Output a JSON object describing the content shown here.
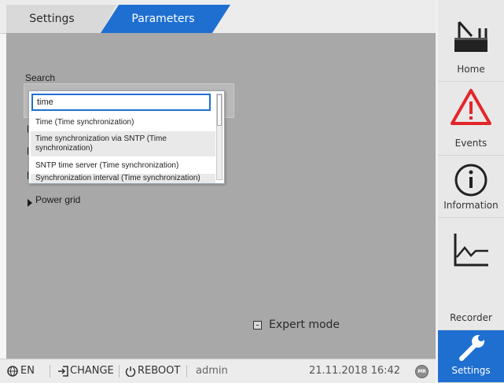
{
  "tabs": [
    {
      "label": "Settings",
      "active": false
    },
    {
      "label": "Parameters",
      "active": true
    }
  ],
  "search": {
    "label": "Search",
    "value": "time"
  },
  "tree_items": [
    {
      "label": ""
    },
    {
      "label": ""
    },
    {
      "label": ""
    },
    {
      "label": "Power grid"
    }
  ],
  "dropdown_options": [
    {
      "label": "Time (Time synchronization)"
    },
    {
      "label": "Time synchronization via SNTP (Time synchronization)"
    },
    {
      "label": "SNTP time server (Time synchronization)"
    },
    {
      "label": "Synchronization interval (Time synchronization)"
    }
  ],
  "expert_mode": {
    "label": "Expert mode",
    "checked": false
  },
  "nav": [
    {
      "label": "Home",
      "icon": "home-transformer-icon"
    },
    {
      "label": "Events",
      "icon": "warning-icon"
    },
    {
      "label": "Information",
      "icon": "info-icon"
    },
    {
      "label": "Recorder",
      "icon": "recorder-chart-icon"
    },
    {
      "label": "Settings",
      "icon": "wrench-icon",
      "active": true
    }
  ],
  "statusbar": {
    "language": "EN",
    "change": "CHANGE",
    "reboot": "REBOOT",
    "user": "admin",
    "datetime": "21.11.2018 16:42",
    "badge": "MR"
  },
  "colors": {
    "accent": "#1f6fd1",
    "warning": "#e3262b",
    "content_bg": "#a8a8a8"
  }
}
